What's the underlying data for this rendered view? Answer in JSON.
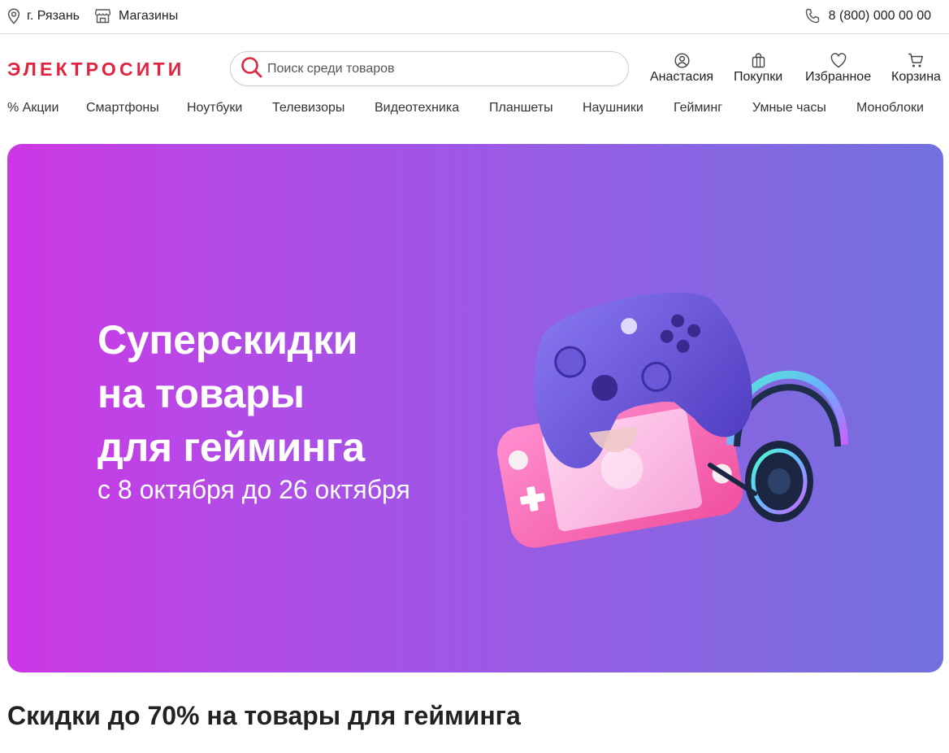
{
  "topbar": {
    "city": "г. Рязань",
    "stores": "Магазины",
    "phone": "8 (800) 000 00 00"
  },
  "header": {
    "logo": "ЭЛЕКТРОСИТИ",
    "search_placeholder": "Поиск среди товаров",
    "profile": "Анастасия",
    "orders": "Покупки",
    "favorites": "Избранное",
    "cart": "Корзина"
  },
  "categories": [
    "% Акции",
    "Смартфоны",
    "Ноутбуки",
    "Телевизоры",
    "Видеотехника",
    "Планшеты",
    "Наушники",
    "Гейминг",
    "Умные часы",
    "Моноблоки"
  ],
  "hero": {
    "title_lines": [
      "Суперскидки",
      "на товары",
      "для гейминга"
    ],
    "subtitle": "с 8 октября до 26 октября"
  },
  "section": {
    "title": "Скидки до 70% на товары для гейминга"
  },
  "colors": {
    "brand": "#e0243f",
    "hero_start": "#cc36e4",
    "hero_end": "#7170de"
  }
}
